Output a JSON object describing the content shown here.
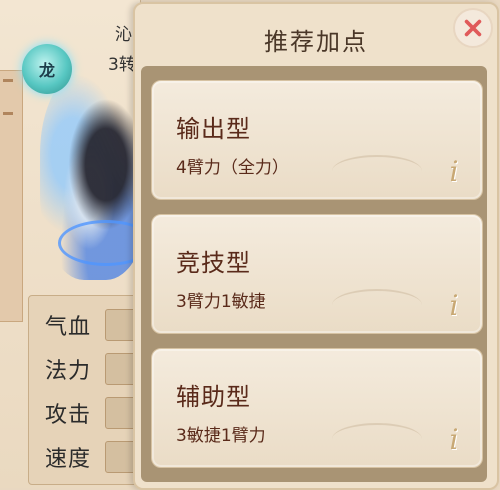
{
  "background": {
    "badge_glyph": "龙",
    "title_fragment": "沁",
    "subtitle_fragment": "3转",
    "stats": [
      {
        "label": "气血"
      },
      {
        "label": "法力"
      },
      {
        "label": "攻击"
      },
      {
        "label": "速度"
      }
    ]
  },
  "popup": {
    "title": "推荐加点",
    "close_icon": "close-x-icon",
    "options": [
      {
        "title": "输出型",
        "desc": "4臂力（全力）",
        "icon": "info-icon"
      },
      {
        "title": "竞技型",
        "desc": "3臂力1敏捷",
        "icon": "info-icon"
      },
      {
        "title": "辅助型",
        "desc": "3敏捷1臂力",
        "icon": "info-icon"
      }
    ]
  },
  "colors": {
    "accent_text": "#5a2a1a",
    "close_x": "#e05a5a",
    "panel_bg": "#efe1cb"
  }
}
